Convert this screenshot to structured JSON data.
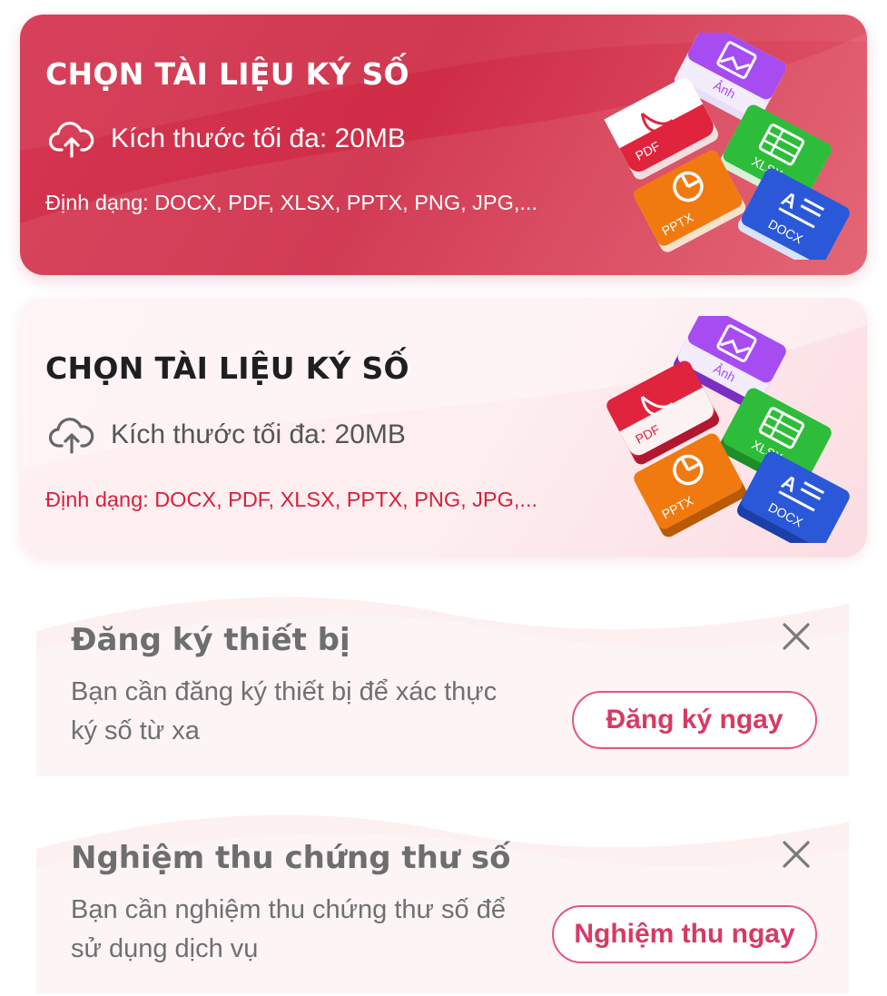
{
  "cards": [
    {
      "title": "CHỌN TÀI LIỆU KÝ SỐ",
      "size_text": "Kích thước tối đa: 20MB",
      "formats": "Định dạng: DOCX, PDF, XLSX, PPTX, PNG, JPG,...",
      "icon": "cloud-upload-icon"
    },
    {
      "title": "CHỌN TÀI LIỆU KÝ SỐ",
      "size_text": "Kích thước tối đa: 20MB",
      "formats": "Định dạng: DOCX, PDF, XLSX, PPTX, PNG, JPG,...",
      "icon": "cloud-upload-icon"
    }
  ],
  "file_labels": {
    "image": "Ảnh",
    "pdf": "PDF",
    "xlsx": "XLSX",
    "pptx": "PPTX",
    "docx": "DOCX"
  },
  "notices": [
    {
      "title": "Đăng ký thiết bị",
      "description": "Bạn cần đăng ký thiết bị để xác thực ký số từ xa",
      "button": "Đăng ký ngay",
      "close_icon": "close-icon"
    },
    {
      "title": "Nghiệm thu chứng thư số",
      "description": "Bạn cần nghiệm thu chứng thư số để sử dụng dịch vụ",
      "button": "Nghiệm thu ngay",
      "close_icon": "close-icon"
    }
  ],
  "colors": {
    "card_red": "#d53651",
    "card_pink": "#fdeef0",
    "accent": "#d83a63",
    "image_tile": "#a64cf0",
    "pdf_tile": "#e0243e",
    "xlsx_tile": "#2ebd3a",
    "pptx_tile": "#f07a10",
    "docx_tile": "#2a58d8"
  }
}
